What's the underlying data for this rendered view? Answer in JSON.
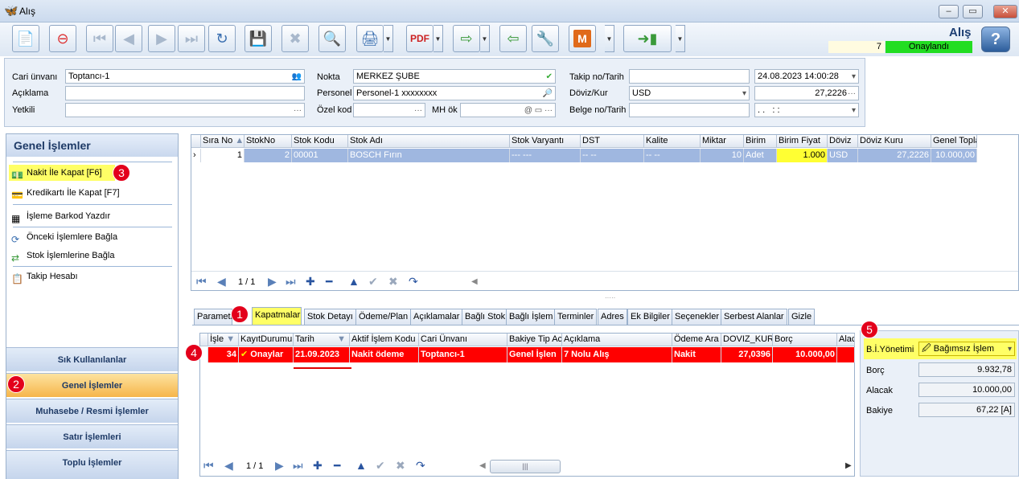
{
  "window": {
    "title": "Alış",
    "app_title": "Alış",
    "doc_number": "7",
    "doc_status": "Onaylandı",
    "help": "?"
  },
  "toolbar_icons": [
    "new-doc-icon",
    "delete-doc-icon",
    "first-icon",
    "prev-icon",
    "next-icon",
    "last-icon",
    "refresh-icon",
    "save-icon",
    "cancel-save-icon",
    "preview-icon",
    "print-icon",
    "pdf-icon",
    "export-icon",
    "import-icon",
    "tools-icon",
    "m-icon",
    "exit-icon"
  ],
  "header": {
    "cari_label": "Cari ünvanı",
    "cari_value": "Toptancı-1",
    "aciklama_label": "Açıklama",
    "aciklama_value": "",
    "yetkili_label": "Yetkili",
    "yetkili_value": "",
    "nokta_label": "Nokta",
    "nokta_value": "MERKEZ ŞUBE",
    "personel_label": "Personel",
    "personel_value": "Personel-1 xxxxxxxx",
    "ozelkod_label": "Özel kod",
    "ozelkod_value": "",
    "mhok_label": "MH ök",
    "mhok_value": "",
    "takip_label": "Takip no/Tarih",
    "takip_value": "",
    "takip_date": "24.08.2023 14:00:28",
    "doviz_label": "Döviz/Kur",
    "doviz_value": "USD",
    "kur_value": "27,2226",
    "belge_label": "Belge no/Tarih",
    "belge_value": "",
    "belge_date": ". .   : :"
  },
  "left_panel": {
    "title": "Genel İşlemler",
    "items": [
      {
        "label": "Nakit İle Kapat [F6]",
        "icon": "cash-icon"
      },
      {
        "label": "Kredikartı İle Kapat [F7]",
        "icon": "credit-card-icon"
      },
      {
        "label": "İşleme Barkod Yazdır",
        "icon": "barcode-icon"
      },
      {
        "label": "Önceki İşlemlere Bağla",
        "icon": "link-icon"
      },
      {
        "label": "Stok İşlemlerine Bağla",
        "icon": "stock-link-icon"
      },
      {
        "label": "Takip Hesabı",
        "icon": "account-icon"
      }
    ],
    "nav": [
      "Sık Kullanılanlar",
      "Genel İşlemler",
      "Muhasebe / Resmi İşlemler",
      "Satır İşlemleri",
      "Toplu İşlemler"
    ]
  },
  "top_grid": {
    "columns": [
      "Sıra No",
      "StokNo",
      "Stok Kodu",
      "Stok Adı",
      "Stok Varyantı",
      "DST",
      "Kalite",
      "Miktar",
      "Birim",
      "Birim Fiyat",
      "Döviz",
      "Döviz Kuru",
      "Genel Toplam"
    ],
    "row": [
      "1",
      "2",
      "00001",
      "BOSCH Fırın",
      "--- ---",
      "-- --",
      "-- --",
      "10",
      "Adet",
      "1.000",
      "USD",
      "27,2226",
      "10.000,00"
    ],
    "pager": "1 / 1"
  },
  "tabs": [
    "Parametre",
    "Kapatmalar",
    "Stok Detayı",
    "Ödeme/Plan",
    "Açıklamalar",
    "Bağlı Stok",
    "Bağlı İşlem",
    "Terminler",
    "Adres",
    "Ek Bilgiler",
    "Seçenekler",
    "Serbest Alanlar",
    "Gizle"
  ],
  "bottom_grid": {
    "columns": [
      "İşle",
      "KayıtDurumu",
      "Tarih",
      "Aktif İşlem Kodu",
      "Cari Ünvanı",
      "Bakiye Tip Ac",
      "Açıklama",
      "Ödeme Ara",
      "DOVIZ_KURU",
      "Borç",
      "Alac"
    ],
    "row": [
      "34",
      "Onaylar",
      "21.09.2023",
      "Nakit ödeme",
      "Toptancı-1",
      "Genel İşlen",
      "7 Nolu Alış",
      "Nakit",
      "27,0396",
      "10.000,00",
      ""
    ],
    "pager": "1 / 1"
  },
  "summary": {
    "yonetim_label": "B.İ.Yönetimi",
    "yonetim_value": "Bağımsız İşlem",
    "borc_label": "Borç",
    "borc_value": "9.932,78",
    "alacak_label": "Alacak",
    "alacak_value": "10.000,00",
    "bakiye_label": "Bakiye",
    "bakiye_value": "67,22 [A]"
  },
  "badges": [
    "1",
    "2",
    "3",
    "4",
    "5"
  ],
  "colors": {
    "highlight_yellow": "#ffff66",
    "row_red": "#ff0000",
    "status_green": "#22dd22",
    "active_nav": "#f6b54a"
  }
}
